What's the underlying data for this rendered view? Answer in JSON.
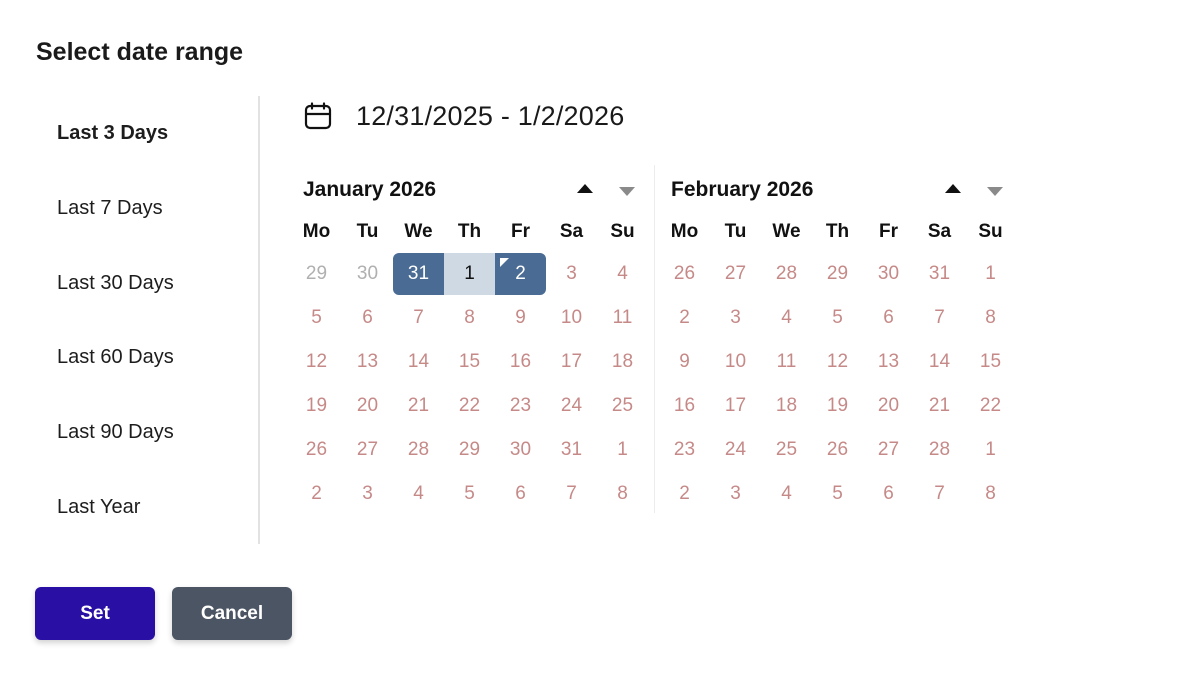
{
  "dialog": {
    "title": "Select date range"
  },
  "presets": [
    {
      "label": "Last 3 Days",
      "active": true
    },
    {
      "label": "Last 7 Days",
      "active": false
    },
    {
      "label": "Last 30 Days",
      "active": false
    },
    {
      "label": "Last 60 Days",
      "active": false
    },
    {
      "label": "Last 90 Days",
      "active": false
    },
    {
      "label": "Last Year",
      "active": false
    }
  ],
  "range": {
    "text": "12/31/2025 - 1/2/2026",
    "icon": "calendar-icon"
  },
  "weekdays": [
    "Mo",
    "Tu",
    "We",
    "Th",
    "Fr",
    "Sa",
    "Su"
  ],
  "calendars": [
    {
      "month": "January 2026",
      "days": [
        {
          "d": "29",
          "s": "other"
        },
        {
          "d": "30",
          "s": "other"
        },
        {
          "d": "31",
          "s": "range-start"
        },
        {
          "d": "1",
          "s": "range-mid"
        },
        {
          "d": "2",
          "s": "range-end"
        },
        {
          "d": "3"
        },
        {
          "d": "4"
        },
        {
          "d": "5"
        },
        {
          "d": "6"
        },
        {
          "d": "7"
        },
        {
          "d": "8"
        },
        {
          "d": "9"
        },
        {
          "d": "10"
        },
        {
          "d": "11"
        },
        {
          "d": "12"
        },
        {
          "d": "13"
        },
        {
          "d": "14"
        },
        {
          "d": "15"
        },
        {
          "d": "16"
        },
        {
          "d": "17"
        },
        {
          "d": "18"
        },
        {
          "d": "19"
        },
        {
          "d": "20"
        },
        {
          "d": "21"
        },
        {
          "d": "22"
        },
        {
          "d": "23"
        },
        {
          "d": "24"
        },
        {
          "d": "25"
        },
        {
          "d": "26"
        },
        {
          "d": "27"
        },
        {
          "d": "28"
        },
        {
          "d": "29"
        },
        {
          "d": "30"
        },
        {
          "d": "31"
        },
        {
          "d": "1"
        },
        {
          "d": "2"
        },
        {
          "d": "3"
        },
        {
          "d": "4"
        },
        {
          "d": "5"
        },
        {
          "d": "6"
        },
        {
          "d": "7"
        },
        {
          "d": "8"
        }
      ]
    },
    {
      "month": "February 2026",
      "days": [
        {
          "d": "26"
        },
        {
          "d": "27"
        },
        {
          "d": "28"
        },
        {
          "d": "29"
        },
        {
          "d": "30"
        },
        {
          "d": "31"
        },
        {
          "d": "1"
        },
        {
          "d": "2"
        },
        {
          "d": "3"
        },
        {
          "d": "4"
        },
        {
          "d": "5"
        },
        {
          "d": "6"
        },
        {
          "d": "7"
        },
        {
          "d": "8"
        },
        {
          "d": "9"
        },
        {
          "d": "10"
        },
        {
          "d": "11"
        },
        {
          "d": "12"
        },
        {
          "d": "13"
        },
        {
          "d": "14"
        },
        {
          "d": "15"
        },
        {
          "d": "16"
        },
        {
          "d": "17"
        },
        {
          "d": "18"
        },
        {
          "d": "19"
        },
        {
          "d": "20"
        },
        {
          "d": "21"
        },
        {
          "d": "22"
        },
        {
          "d": "23"
        },
        {
          "d": "24"
        },
        {
          "d": "25"
        },
        {
          "d": "26"
        },
        {
          "d": "27"
        },
        {
          "d": "28"
        },
        {
          "d": "1"
        },
        {
          "d": "2"
        },
        {
          "d": "3"
        },
        {
          "d": "4"
        },
        {
          "d": "5"
        },
        {
          "d": "6"
        },
        {
          "d": "7"
        },
        {
          "d": "8"
        }
      ]
    }
  ],
  "buttons": {
    "set": "Set",
    "cancel": "Cancel"
  },
  "colors": {
    "accent": "#2a0fa5",
    "cancel": "#4b5563",
    "range_edge": "#4a6b94",
    "range_mid": "#cfd9e4",
    "day_text": "#c58a88",
    "other_month": "#b0b0b0"
  }
}
